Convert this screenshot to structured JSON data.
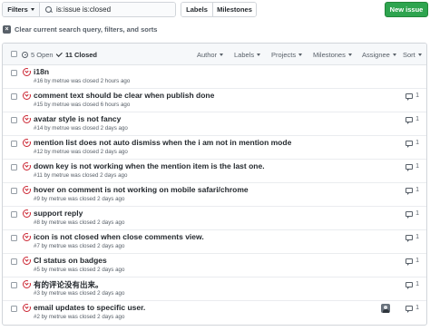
{
  "toolbar": {
    "filters_label": "Filters",
    "search_value": "is:issue is:closed",
    "labels_label": "Labels",
    "milestones_label": "Milestones",
    "new_issue_label": "New issue"
  },
  "clear_filters_label": "Clear current search query, filters, and sorts",
  "header": {
    "open_label": "5 Open",
    "closed_label": "11 Closed",
    "dropdowns": [
      "Author",
      "Labels",
      "Projects",
      "Milestones",
      "Assignee",
      "Sort"
    ]
  },
  "issues": [
    {
      "title": "i18n",
      "meta": "#16 by metrue was closed 2 hours ago",
      "comments": ""
    },
    {
      "title": "comment text should be clear when publish done",
      "meta": "#15 by metrue was closed 6 hours ago",
      "comments": "1"
    },
    {
      "title": "avatar style is not fancy",
      "meta": "#14 by metrue was closed 2 days ago",
      "comments": "1"
    },
    {
      "title": "mention list does not auto dismiss when the i am not in mention mode",
      "meta": "#12 by metrue was closed 2 days ago",
      "comments": "1"
    },
    {
      "title": "down key is not working when the mention item is the last one.",
      "meta": "#11 by metrue was closed 2 days ago",
      "comments": "1"
    },
    {
      "title": "hover on comment is not working on mobile safari/chrome",
      "meta": "#9 by metrue was closed 2 days ago",
      "comments": "1"
    },
    {
      "title": "support reply",
      "meta": "#8 by metrue was closed 2 days ago",
      "comments": "1"
    },
    {
      "title": "icon is not closed when close comments view.",
      "meta": "#7 by metrue was closed 2 days ago",
      "comments": "1"
    },
    {
      "title": "CI status on badges",
      "meta": "#5 by metrue was closed 2 days ago",
      "comments": "1"
    },
    {
      "title": "有的评论没有出来。",
      "meta": "#3 by metrue was closed 2 days ago",
      "comments": "1"
    },
    {
      "title": "email updates to specific user.",
      "meta": "#2 by metrue was closed 2 days ago",
      "comments": "1"
    }
  ],
  "colors": {
    "closed_icon": "#cb2431",
    "new_issue_bg": "#2ea44f",
    "muted_text": "#586069"
  },
  "icons": {
    "closed_issue": "issue-closed-icon",
    "comment": "comment-icon",
    "search": "search-icon"
  }
}
